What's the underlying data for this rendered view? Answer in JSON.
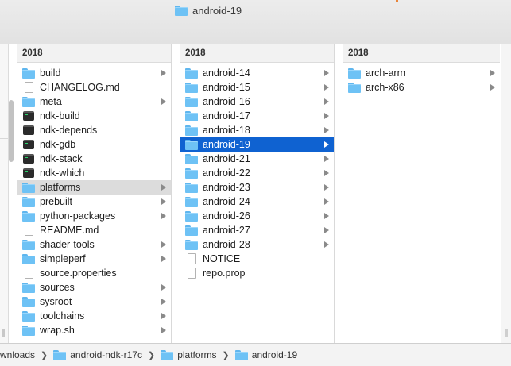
{
  "window": {
    "title": "android-19"
  },
  "columns": [
    {
      "header": "2018",
      "items": [
        {
          "label": "build",
          "icon": "folder-icon",
          "arrow": true,
          "selected": ""
        },
        {
          "label": "CHANGELOG.md",
          "icon": "document-icon",
          "arrow": false,
          "selected": ""
        },
        {
          "label": "meta",
          "icon": "folder-icon",
          "arrow": true,
          "selected": ""
        },
        {
          "label": "ndk-build",
          "icon": "terminal-exec-icon",
          "arrow": false,
          "selected": ""
        },
        {
          "label": "ndk-depends",
          "icon": "terminal-exec-icon",
          "arrow": false,
          "selected": ""
        },
        {
          "label": "ndk-gdb",
          "icon": "terminal-exec-icon",
          "arrow": false,
          "selected": ""
        },
        {
          "label": "ndk-stack",
          "icon": "terminal-exec-icon",
          "arrow": false,
          "selected": ""
        },
        {
          "label": "ndk-which",
          "icon": "terminal-exec-icon",
          "arrow": false,
          "selected": ""
        },
        {
          "label": "platforms",
          "icon": "folder-icon",
          "arrow": true,
          "selected": "gray"
        },
        {
          "label": "prebuilt",
          "icon": "folder-icon",
          "arrow": true,
          "selected": ""
        },
        {
          "label": "python-packages",
          "icon": "folder-icon",
          "arrow": true,
          "selected": ""
        },
        {
          "label": "README.md",
          "icon": "document-icon",
          "arrow": false,
          "selected": ""
        },
        {
          "label": "shader-tools",
          "icon": "folder-icon",
          "arrow": true,
          "selected": ""
        },
        {
          "label": "simpleperf",
          "icon": "folder-icon",
          "arrow": true,
          "selected": ""
        },
        {
          "label": "source.properties",
          "icon": "document-icon",
          "arrow": false,
          "selected": ""
        },
        {
          "label": "sources",
          "icon": "folder-icon",
          "arrow": true,
          "selected": ""
        },
        {
          "label": "sysroot",
          "icon": "folder-icon",
          "arrow": true,
          "selected": ""
        },
        {
          "label": "toolchains",
          "icon": "folder-icon",
          "arrow": true,
          "selected": ""
        },
        {
          "label": "wrap.sh",
          "icon": "folder-icon",
          "arrow": true,
          "selected": ""
        }
      ]
    },
    {
      "header": "2018",
      "items": [
        {
          "label": "android-14",
          "icon": "folder-icon",
          "arrow": true,
          "selected": ""
        },
        {
          "label": "android-15",
          "icon": "folder-icon",
          "arrow": true,
          "selected": ""
        },
        {
          "label": "android-16",
          "icon": "folder-icon",
          "arrow": true,
          "selected": ""
        },
        {
          "label": "android-17",
          "icon": "folder-icon",
          "arrow": true,
          "selected": ""
        },
        {
          "label": "android-18",
          "icon": "folder-icon",
          "arrow": true,
          "selected": ""
        },
        {
          "label": "android-19",
          "icon": "folder-icon",
          "arrow": true,
          "selected": "blue"
        },
        {
          "label": "android-21",
          "icon": "folder-icon",
          "arrow": true,
          "selected": ""
        },
        {
          "label": "android-22",
          "icon": "folder-icon",
          "arrow": true,
          "selected": ""
        },
        {
          "label": "android-23",
          "icon": "folder-icon",
          "arrow": true,
          "selected": ""
        },
        {
          "label": "android-24",
          "icon": "folder-icon",
          "arrow": true,
          "selected": ""
        },
        {
          "label": "android-26",
          "icon": "folder-icon",
          "arrow": true,
          "selected": ""
        },
        {
          "label": "android-27",
          "icon": "folder-icon",
          "arrow": true,
          "selected": ""
        },
        {
          "label": "android-28",
          "icon": "folder-icon",
          "arrow": true,
          "selected": ""
        },
        {
          "label": "NOTICE",
          "icon": "document-icon",
          "arrow": false,
          "selected": ""
        },
        {
          "label": "repo.prop",
          "icon": "document-icon",
          "arrow": false,
          "selected": ""
        }
      ]
    },
    {
      "header": "2018",
      "items": [
        {
          "label": "arch-arm",
          "icon": "folder-icon",
          "arrow": true,
          "selected": ""
        },
        {
          "label": "arch-x86",
          "icon": "folder-icon",
          "arrow": true,
          "selected": ""
        }
      ]
    }
  ],
  "pathbar": [
    {
      "label": "wnloads",
      "icon": ""
    },
    {
      "label": "android-ndk-r17c",
      "icon": "folder-icon"
    },
    {
      "label": "platforms",
      "icon": "folder-icon"
    },
    {
      "label": "android-19",
      "icon": "folder-icon"
    }
  ],
  "colors": {
    "selection_blue": "#0f62d1",
    "selection_gray": "#dcdcdc",
    "folder": "#6ec2f5"
  }
}
